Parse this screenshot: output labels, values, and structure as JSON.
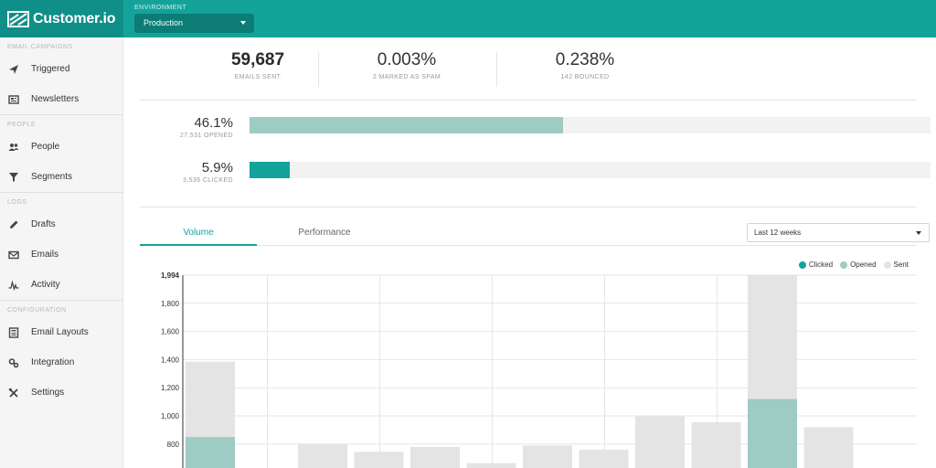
{
  "brand": {
    "name": "Customer.io"
  },
  "environment": {
    "label": "ENVIRONMENT",
    "value": "Production"
  },
  "sidebar": {
    "sections": [
      {
        "title": "EMAIL CAMPAIGNS",
        "items": [
          {
            "label": "Triggered",
            "icon": "paper-plane-icon"
          },
          {
            "label": "Newsletters",
            "icon": "newspaper-icon"
          }
        ]
      },
      {
        "title": "PEOPLE",
        "items": [
          {
            "label": "People",
            "icon": "people-icon"
          },
          {
            "label": "Segments",
            "icon": "funnel-icon"
          }
        ]
      },
      {
        "title": "LOGS",
        "items": [
          {
            "label": "Drafts",
            "icon": "pencil-icon"
          },
          {
            "label": "Emails",
            "icon": "envelope-icon"
          },
          {
            "label": "Activity",
            "icon": "activity-icon"
          }
        ]
      },
      {
        "title": "CONFIGURATION",
        "items": [
          {
            "label": "Email Layouts",
            "icon": "layout-icon"
          },
          {
            "label": "Integration",
            "icon": "gears-icon"
          },
          {
            "label": "Settings",
            "icon": "tools-icon"
          }
        ]
      }
    ]
  },
  "stats": {
    "sent": {
      "value": "59,687",
      "label": "EMAILS SENT"
    },
    "spam": {
      "value": "0.003%",
      "label": "2 MARKED AS SPAM"
    },
    "bounced": {
      "value": "0.238%",
      "label": "142 BOUNCED"
    }
  },
  "rates": {
    "opened": {
      "value": "46.1%",
      "label": "27,531 OPENED",
      "fraction": 0.461,
      "color": "#9ecbc4"
    },
    "clicked": {
      "value": "5.9%",
      "label": "3,536 CLICKED",
      "fraction": 0.059,
      "color": "#14a39a"
    }
  },
  "tabs": {
    "volume": "Volume",
    "performance": "Performance"
  },
  "period": {
    "value": "Last 12 weeks"
  },
  "chart_data": {
    "type": "bar",
    "y_ticks": [
      "1,994",
      "1,800",
      "1,600",
      "1,400",
      "1,200",
      "1,000",
      "800"
    ],
    "ylim": [
      0,
      1994
    ],
    "series": [
      {
        "name": "Clicked",
        "color": "#14a39a",
        "values": [
          0,
          0,
          0,
          0,
          0,
          0,
          0,
          0,
          0,
          0,
          0,
          0
        ]
      },
      {
        "name": "Opened",
        "color": "#9ecbc4",
        "values": [
          850,
          0,
          0,
          0,
          0,
          0,
          0,
          0,
          0,
          0,
          1120,
          0
        ]
      },
      {
        "name": "Sent",
        "color": "#e4e4e4",
        "values": [
          1385,
          0,
          800,
          745,
          780,
          665,
          790,
          760,
          1000,
          955,
          1994,
          920
        ]
      }
    ],
    "legend": "top-right",
    "grid": true
  }
}
